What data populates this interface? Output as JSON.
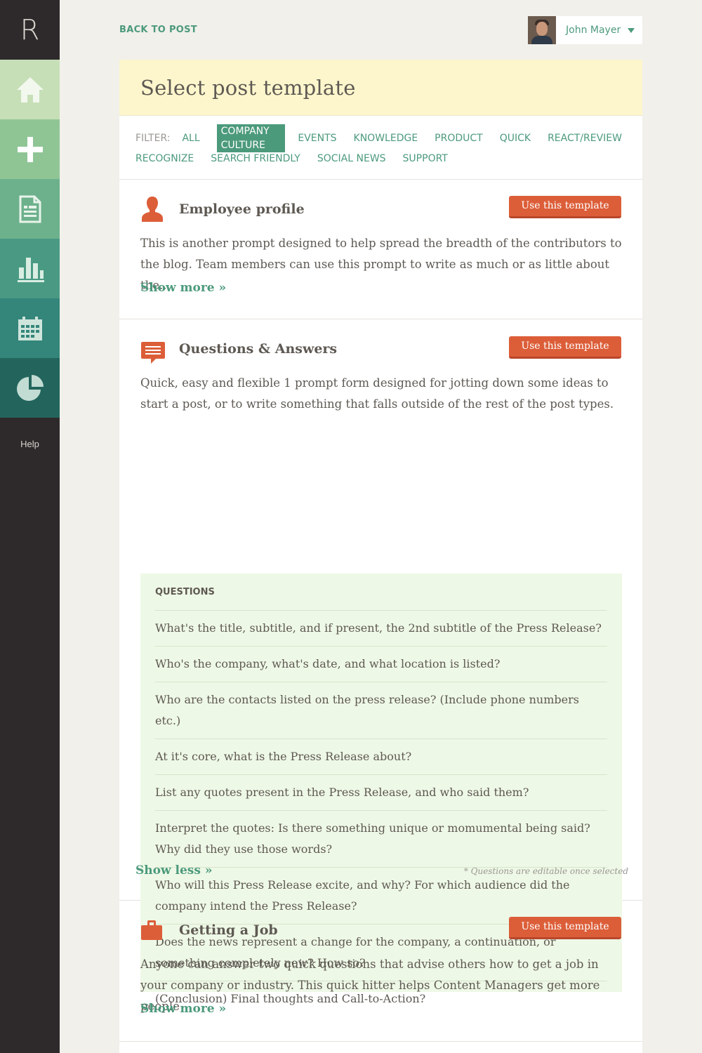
{
  "sidebar": {
    "logo": "R",
    "items": [
      {
        "name": "home-icon",
        "color": "#c7dfb7"
      },
      {
        "name": "plus-icon",
        "color": "#8fc595"
      },
      {
        "name": "document-icon",
        "color": "#6db18c"
      },
      {
        "name": "bar-chart-icon",
        "color": "#4a9a83"
      },
      {
        "name": "calendar-icon",
        "color": "#34857a"
      },
      {
        "name": "pie-chart-icon",
        "color": "#23655c"
      }
    ],
    "help": "Help"
  },
  "header": {
    "back_link": "BACK TO POST",
    "user_name": "John Mayer"
  },
  "page": {
    "title": "Select post template"
  },
  "filters": {
    "label": "FILTER:",
    "row1": [
      "ALL",
      "COMPANY CULTURE",
      "EVENTS",
      "KNOWLEDGE",
      "PRODUCT",
      "QUICK",
      "REACT/REVIEW"
    ],
    "row2": [
      "RECOGNIZE",
      "SEARCH FRIENDLY",
      "SOCIAL NEWS",
      "SUPPORT"
    ],
    "active": "COMPANY CULTURE"
  },
  "templates": [
    {
      "title": "Employee profile",
      "button": "Use this template",
      "description": "This is another prompt designed to help spread the breadth of the contributors to the blog. Team members can use this prompt to write as much or as little about the...",
      "link": "Show more »"
    },
    {
      "title": "Questions & Answers",
      "button": "Use this template",
      "description": "Quick, easy and flexible 1 prompt form designed for jotting down some ideas to start a post, or to write something that falls outside of the rest of the post types.",
      "questions_heading": "QUESTIONS",
      "questions": [
        "What's the title, subtitle, and if present, the 2nd subtitle of the Press Release?",
        "Who's the company, what's date, and what location is listed?",
        "Who are the contacts listed on the press release? (Include phone numbers etc.)",
        "At it's core, what is the Press Release about?",
        "List any quotes present in the Press Release, and who said them?",
        "Interpret the quotes: Is there something unique or momumental being said?  Why did they use those words?",
        "Who will this Press Release excite, and why? For which audience did the company intend the Press Release?",
        "Does the news represent a change for the company, a continuation, or something completely new? How so?",
        "(Conclusion) Final thoughts and Call-to-Action?"
      ],
      "link": "Show less »",
      "note": "* Questions are editable once selected"
    },
    {
      "title": "Getting a Job",
      "button": "Use this template",
      "description": "Anyone can answer two quick questions that advise others how to get a job in your company or industry. This quick hitter helps Content Managers get more people",
      "link": "Show more »"
    }
  ],
  "colors": {
    "accent_green": "#4c9a7c",
    "button_orange": "#dc5e39",
    "sidebar_dark": "#2e2a2b",
    "header_yellow": "#fdf6cc",
    "questions_bg": "#eef8e6"
  }
}
